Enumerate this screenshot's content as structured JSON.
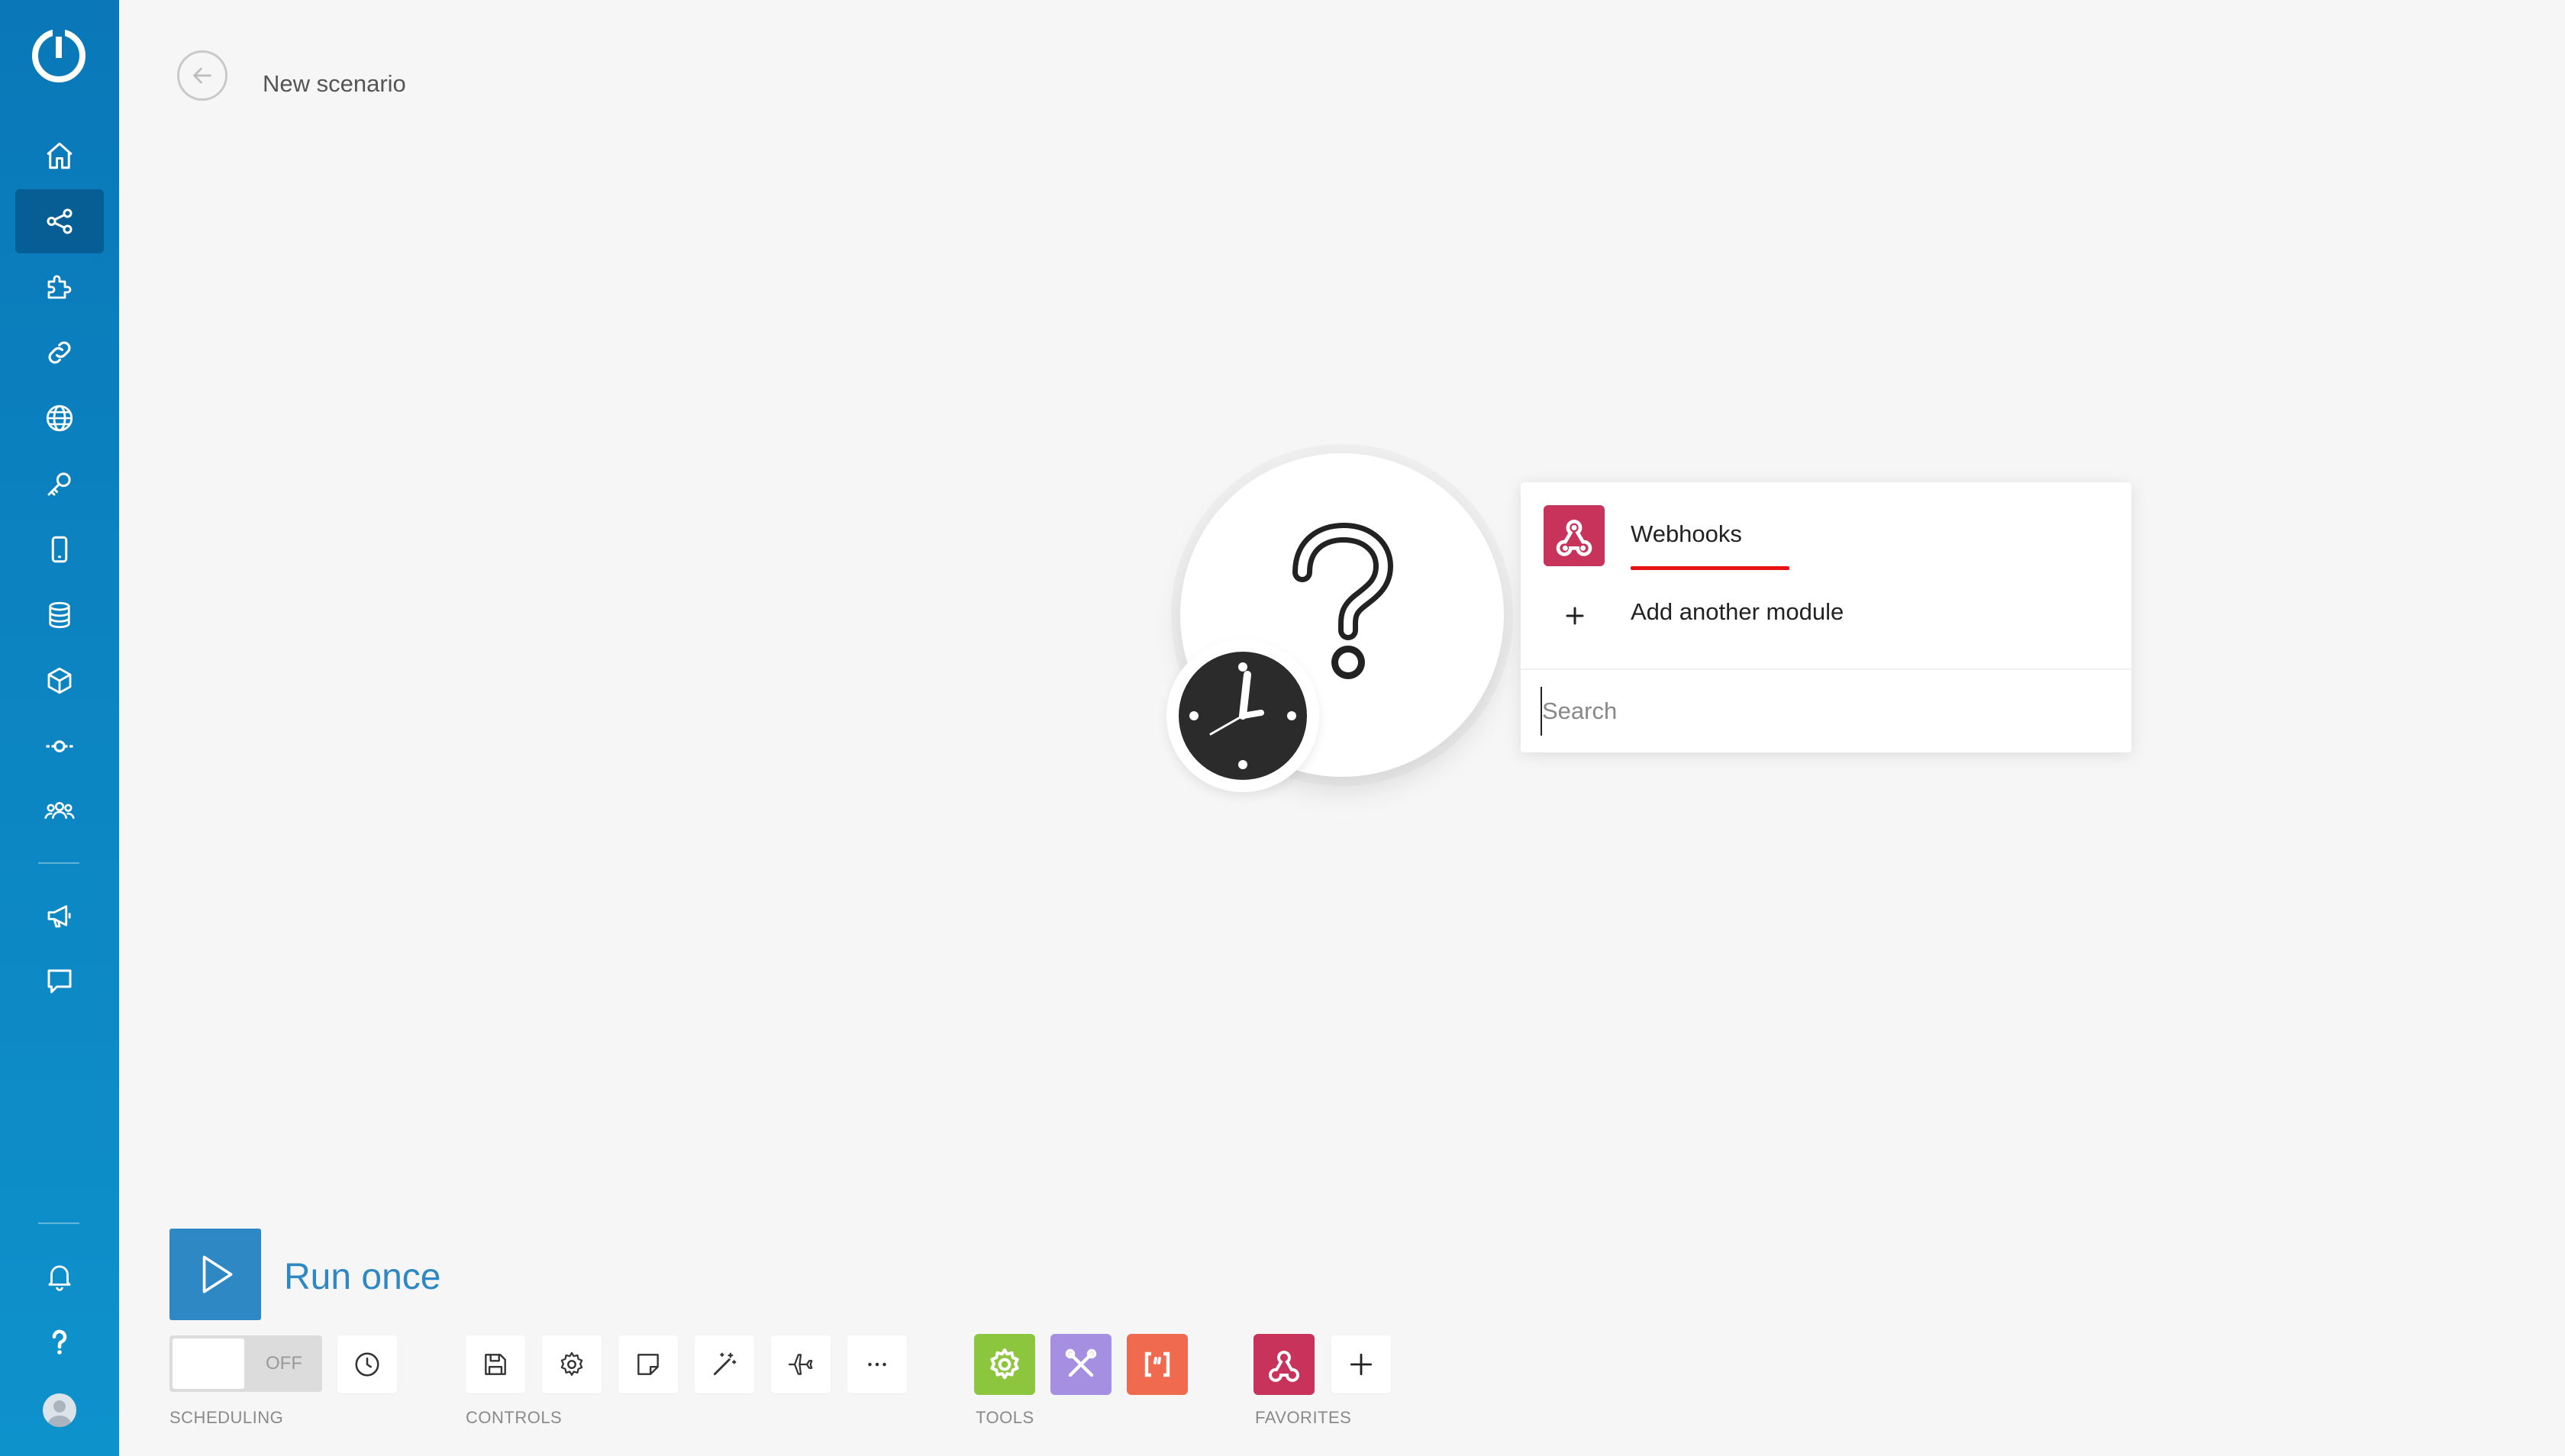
{
  "sidebar": {
    "items": [
      {
        "name": "home"
      },
      {
        "name": "scenarios",
        "active": true
      },
      {
        "name": "templates"
      },
      {
        "name": "connections"
      },
      {
        "name": "webhooks"
      },
      {
        "name": "keys"
      },
      {
        "name": "devices"
      },
      {
        "name": "data-stores"
      },
      {
        "name": "data-structures"
      },
      {
        "name": "custom-apps"
      },
      {
        "name": "team"
      },
      {
        "name": "whats-new"
      },
      {
        "name": "feedback"
      },
      {
        "name": "notifications"
      },
      {
        "name": "help"
      }
    ],
    "accent": "#0a78b8"
  },
  "header": {
    "title": "New scenario"
  },
  "module_menu": {
    "items": [
      {
        "label": "Webhooks",
        "icon": "webhooks-icon",
        "color": "#c8335b"
      },
      {
        "label": "Add another module",
        "icon": "plus-icon"
      }
    ],
    "search_placeholder": "Search"
  },
  "toolbar": {
    "run_label": "Run once",
    "toggle_label": "OFF",
    "sections": {
      "scheduling": "SCHEDULING",
      "controls": "CONTROLS",
      "tools": "TOOLS",
      "favorites": "FAVORITES"
    },
    "tool_colors": {
      "tools": "#8cc63f",
      "flow": "#a58fe0",
      "text": "#f06a50",
      "webhooks": "#c8335b"
    }
  }
}
